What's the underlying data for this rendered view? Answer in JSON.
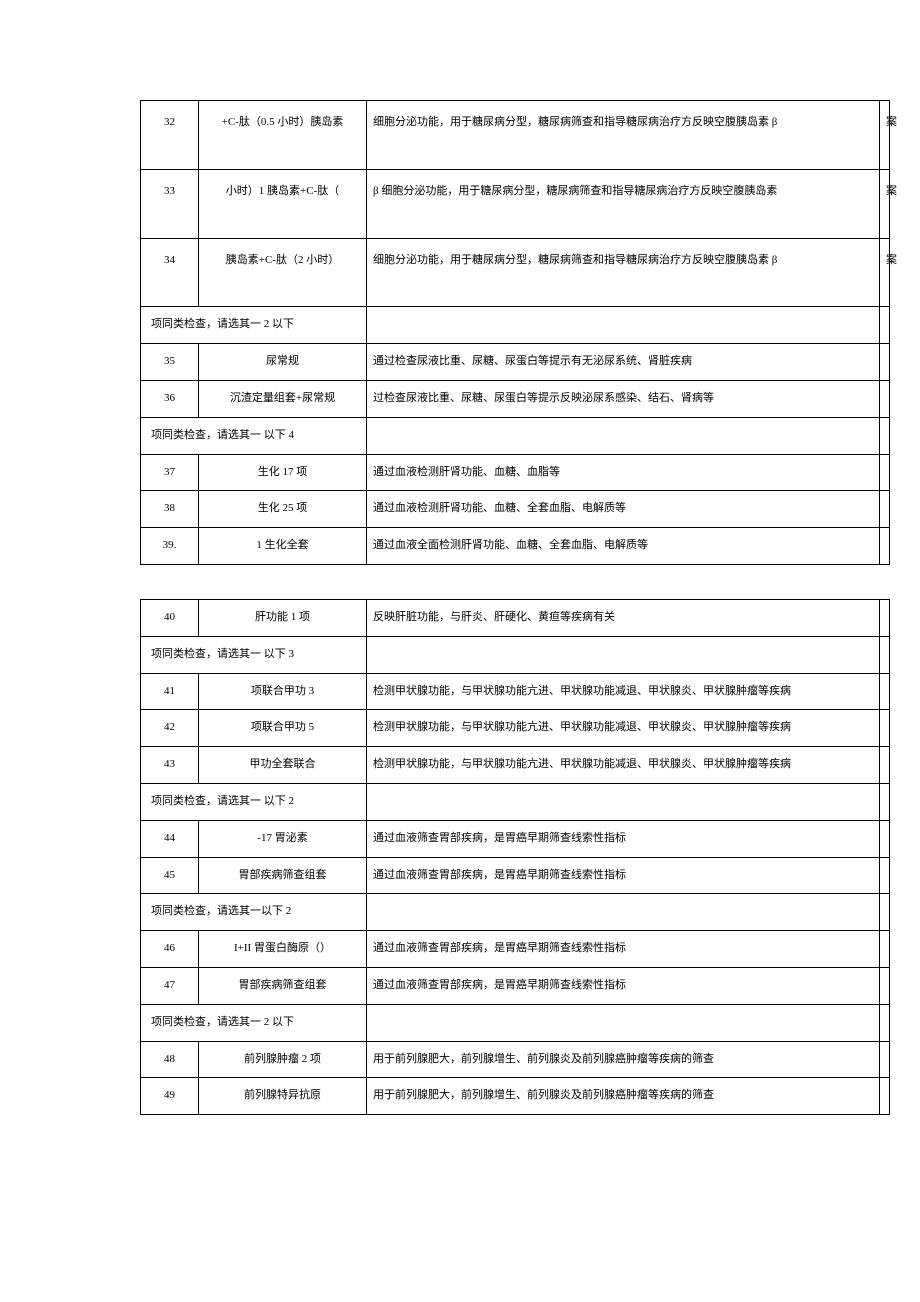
{
  "t1": {
    "rows": [
      {
        "n": "32",
        "name": "+C-肽（0.5 小时）胰岛素",
        "desc": "细胞分泌功能，用于糖尿病分型，糖尿病筛查和指导糖尿病治疗方反映空腹胰岛素  β",
        "end": "案",
        "tall": true
      },
      {
        "n": "33",
        "name": "小时）1 胰岛素+C-肽（",
        "desc": "β   细胞分泌功能，用于糖尿病分型，糖尿病筛查和指导糖尿病治疗方反映空腹胰岛素",
        "end": "案",
        "tall": true
      },
      {
        "n": "34",
        "name": "胰岛素+C-肽（2 小时）",
        "desc": "细胞分泌功能，用于糖尿病分型，糖尿病筛查和指导糖尿病治疗方反映空腹胰岛素  β",
        "end": "案",
        "tall": true
      },
      {
        "group": "项同类检查，请选其一   2 以下"
      },
      {
        "n": "35",
        "name": "尿常规",
        "desc": "通过检查尿液比重、尿糖、尿蛋白等提示有无泌尿系统、肾脏疾病"
      },
      {
        "n": "36",
        "name": "沉渣定量组套+尿常规",
        "desc": "过检查尿液比重、尿糖、尿蛋白等提示反映泌尿系感染、结石、肾病等"
      },
      {
        "group": "项同类检查，请选其一   以下 4"
      },
      {
        "n": "37",
        "name": "生化 17 项",
        "desc": "通过血液检测肝肾功能、血糖、血脂等"
      },
      {
        "n": "38",
        "name": "生化 25 项",
        "desc": "通过血液检测肝肾功能、血糖、全套血脂、电解质等"
      },
      {
        "n": "39.",
        "name": "1 生化全套",
        "desc": "通过血液全面检测肝肾功能、血糖、全套血脂、电解质等"
      }
    ]
  },
  "t2": {
    "rows": [
      {
        "n": "40",
        "name": "肝功能 1 项",
        "desc": "反映肝脏功能，与肝炎、肝硬化、黄疸等疾病有关"
      },
      {
        "group": "项同类检查，请选其一 以下 3"
      },
      {
        "n": "41",
        "name": "项联合甲功 3",
        "desc": "检测甲状腺功能，与甲状腺功能亢进、甲状腺功能减退、甲状腺炎、甲状腺肿瘤等疾病"
      },
      {
        "n": "42",
        "name": "项联合甲功 5",
        "desc": "检测甲状腺功能，与甲状腺功能亢进、甲状腺功能减退、甲状腺炎、甲状腺肿瘤等疾病"
      },
      {
        "n": "43",
        "name": "甲功全套联合",
        "desc": "检测甲状腺功能，与甲状腺功能亢进、甲状腺功能减退、甲状腺炎、甲状腺肿瘤等疾病"
      },
      {
        "group": "项同类检查，请选其一 以下 2"
      },
      {
        "n": "44",
        "name": "-17 胃泌素",
        "desc": "通过血液筛查胃部疾病，是胃癌早期筛查线索性指标"
      },
      {
        "n": "45",
        "name": "胃部疾病筛查组套",
        "desc": "通过血液筛查胃部疾病，是胃癌早期筛查线索性指标"
      },
      {
        "group": "项同类检查，请选其一以下 2"
      },
      {
        "n": "46",
        "name": "I+II 胃蛋白酶原（）",
        "desc": "通过血液筛查胃部疾病，是胃癌早期筛查线索性指标"
      },
      {
        "n": "47",
        "name": "胃部疾病筛查组套",
        "desc": "通过血液筛查胃部疾病，是胃癌早期筛查线索性指标"
      },
      {
        "group": "项同类检查，请选其一 2 以下"
      },
      {
        "n": "48",
        "name": "前列腺肿瘤 2 项",
        "desc": "用于前列腺肥大，前列腺增生、前列腺炎及前列腺癌肿瘤等疾病的筛查"
      },
      {
        "n": "49",
        "name": "前列腺特异抗原",
        "desc": "用于前列腺肥大，前列腺增生、前列腺炎及前列腺癌肿瘤等疾病的筛查"
      }
    ]
  }
}
